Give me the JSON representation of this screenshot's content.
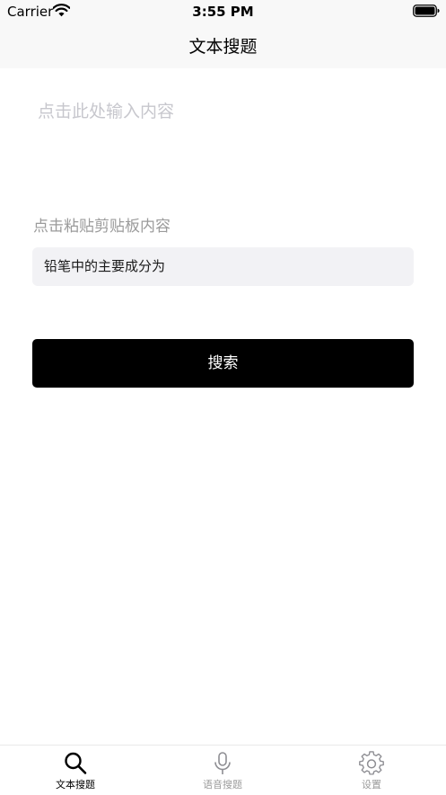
{
  "status_bar": {
    "carrier": "Carrier",
    "time": "3:55 PM",
    "icons": [
      "wifi-icon",
      "battery-icon"
    ]
  },
  "nav": {
    "title": "文本搜题"
  },
  "question": {
    "placeholder": "点击此处输入内容",
    "value": ""
  },
  "paste": {
    "label": "点击粘贴剪贴板内容",
    "clipboard_text": "铅笔中的主要成分为"
  },
  "search_button": {
    "label": "搜索"
  },
  "tab_bar": {
    "tabs": [
      {
        "label": "文本搜题",
        "icon": "search-icon",
        "active": true
      },
      {
        "label": "语音搜题",
        "icon": "microphone-icon",
        "active": false
      },
      {
        "label": "设置",
        "icon": "gear-icon",
        "active": false
      }
    ],
    "active_color": "#000000",
    "inactive_color": "#9b9b9b"
  },
  "colors": {
    "button_background": "#000000",
    "clipboard_background": "#f2f2f5",
    "bar_background": "#f8f8f8"
  }
}
